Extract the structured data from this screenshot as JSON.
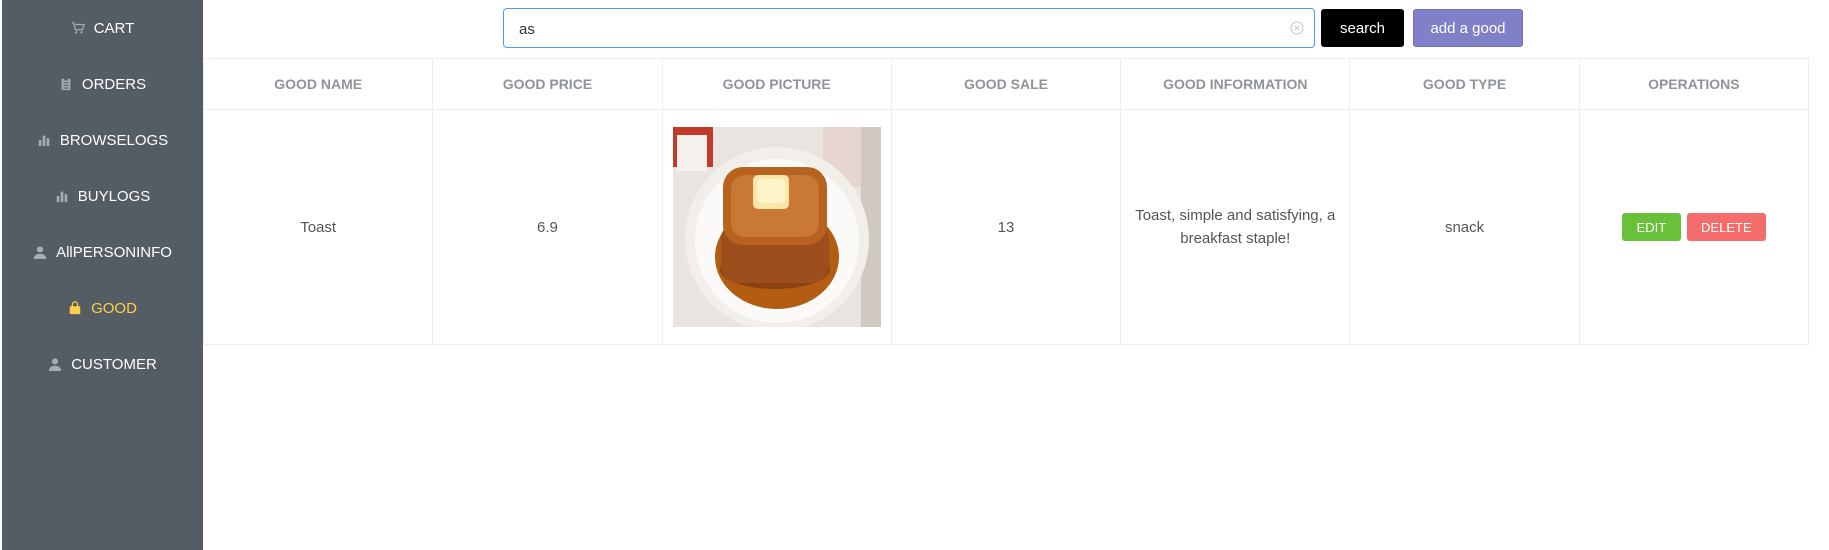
{
  "sidebar": {
    "items": [
      {
        "label": "CART",
        "icon": "cart-icon"
      },
      {
        "label": "ORDERS",
        "icon": "clipboard-icon"
      },
      {
        "label": "BROWSELOGS",
        "icon": "bar-chart-icon"
      },
      {
        "label": "BUYLOGS",
        "icon": "bar-chart-icon"
      },
      {
        "label": "AllPERSONINFO",
        "icon": "user-icon"
      },
      {
        "label": "GOOD",
        "icon": "bag-icon",
        "active": true
      },
      {
        "label": "CUSTOMER",
        "icon": "user-icon"
      }
    ]
  },
  "search": {
    "value": "as",
    "button_label": "search"
  },
  "add_button_label": "add a good",
  "table": {
    "headers": [
      "GOOD NAME",
      "GOOD PRICE",
      "GOOD PICTURE",
      "GOOD SALE",
      "GOOD INFORMATION",
      "GOOD TYPE",
      "OPERATIONS"
    ],
    "rows": [
      {
        "name": "Toast",
        "price": "6.9",
        "picture_alt": "French toast with butter and syrup",
        "sale": "13",
        "information": "Toast, simple and satisfying, a breakfast staple!",
        "type": "snack",
        "edit_label": "EDIT",
        "delete_label": "DELETE"
      }
    ]
  },
  "colors": {
    "sidebar_bg": "#545c64",
    "active_text": "#ffd04b",
    "edit": "#67c23a",
    "delete": "#f56c6c",
    "add": "#8080c8"
  }
}
